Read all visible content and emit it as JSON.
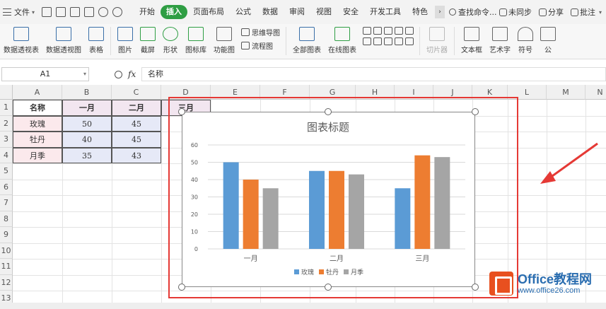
{
  "menubar": {
    "file_label": "文件",
    "tabs": [
      {
        "label": "开始",
        "active": false
      },
      {
        "label": "插入",
        "active": true
      },
      {
        "label": "页面布局",
        "active": false
      },
      {
        "label": "公式",
        "active": false
      },
      {
        "label": "数据",
        "active": false
      },
      {
        "label": "审阅",
        "active": false
      },
      {
        "label": "视图",
        "active": false
      },
      {
        "label": "安全",
        "active": false
      },
      {
        "label": "开发工具",
        "active": false
      },
      {
        "label": "特色",
        "active": false
      }
    ],
    "search_label": "查找命令...",
    "sync_label": "未同步",
    "share_label": "分享",
    "comment_label": "批注"
  },
  "ribbon": {
    "pivot_table": "数据透视表",
    "pivot_chart": "数据透视图",
    "table": "表格",
    "picture": "图片",
    "screenshot": "截屏",
    "shape": "形状",
    "icon_library": "图标库",
    "function_chart": "功能图",
    "mindmap": "思维导图",
    "flowchart": "流程图",
    "all_charts": "全部图表",
    "online_charts": "在线图表",
    "slicer": "切片器",
    "textbox": "文本框",
    "wordart": "艺术字",
    "symbol": "符号",
    "formula_more": "公"
  },
  "formula_bar": {
    "cell_ref": "A1",
    "fx_label": "fx",
    "value": "名称"
  },
  "sheet": {
    "columns": [
      "A",
      "B",
      "C",
      "D",
      "E",
      "F",
      "G",
      "H",
      "I",
      "J",
      "K",
      "L",
      "M",
      "N"
    ],
    "rows": [
      "1",
      "2",
      "3",
      "4",
      "5",
      "6",
      "7",
      "8",
      "9",
      "10",
      "11",
      "12",
      "13"
    ],
    "headers": [
      "名称",
      "一月",
      "二月",
      "三月"
    ],
    "data": [
      [
        "玫瑰",
        "50",
        "45"
      ],
      [
        "牡丹",
        "40",
        "45"
      ],
      [
        "月季",
        "35",
        "43"
      ]
    ]
  },
  "chart_data": {
    "type": "bar",
    "title": "图表标题",
    "categories": [
      "一月",
      "二月",
      "三月"
    ],
    "series": [
      {
        "name": "玫瑰",
        "values": [
          50,
          45,
          35
        ],
        "color": "#5b9bd5"
      },
      {
        "name": "牡丹",
        "values": [
          40,
          45,
          54
        ],
        "color": "#ed7d31"
      },
      {
        "name": "月季",
        "values": [
          35,
          43,
          53
        ],
        "color": "#a5a5a5"
      }
    ],
    "yticks": [
      "0",
      "10",
      "20",
      "30",
      "40",
      "50",
      "60"
    ],
    "ylim": [
      0,
      60
    ],
    "grid": true,
    "legend": "bottom"
  },
  "watermark": {
    "title": "Office教程网",
    "url": "www.office26.com"
  },
  "colors": {
    "accent_green": "#2f9e44",
    "highlight_red": "#e53935"
  }
}
